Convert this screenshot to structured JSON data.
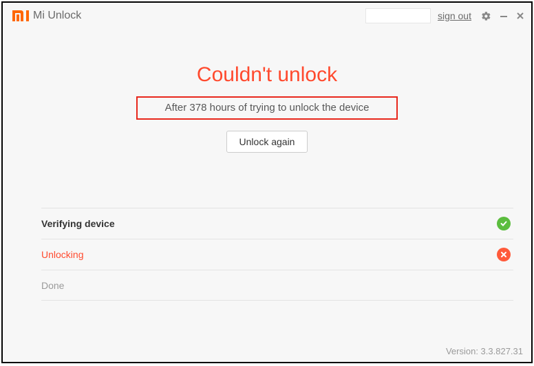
{
  "titlebar": {
    "app_name": "Mi Unlock",
    "signout_label": "sign out"
  },
  "main": {
    "headline": "Couldn't unlock",
    "message": "After 378 hours of trying to unlock the device",
    "action_label": "Unlock again"
  },
  "steps": [
    {
      "label": "Verifying device",
      "state": "ok"
    },
    {
      "label": "Unlocking",
      "state": "error"
    },
    {
      "label": "Done",
      "state": "pending"
    }
  ],
  "footer": {
    "version_prefix": "Version: ",
    "version": "3.3.827.31"
  }
}
